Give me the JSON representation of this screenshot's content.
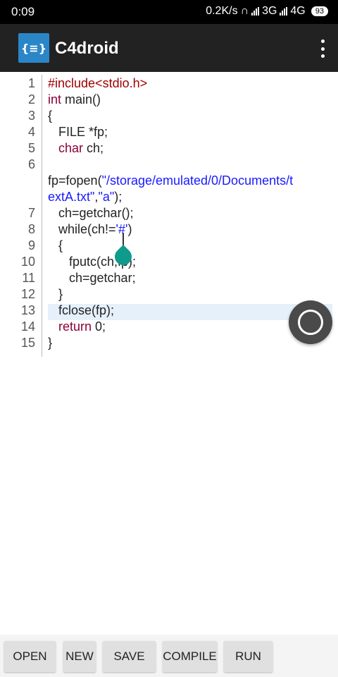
{
  "status_bar": {
    "time": "0:09",
    "net_speed": "0.2K/s",
    "net_3g": "3G",
    "net_4g": "4G",
    "battery": "93"
  },
  "app_bar": {
    "logo_text": "{≡}",
    "title": "C4droid"
  },
  "editor": {
    "current_line": 13,
    "lines": [
      {
        "n": "1",
        "tokens": [
          {
            "t": "#include<stdio.h>",
            "c": "pp"
          }
        ]
      },
      {
        "n": "2",
        "tokens": [
          {
            "t": "int",
            "c": "kw"
          },
          {
            "t": " main()",
            "c": ""
          }
        ]
      },
      {
        "n": "3",
        "tokens": [
          {
            "t": "{",
            "c": ""
          }
        ]
      },
      {
        "n": "4",
        "tokens": [
          {
            "t": "   FILE *fp;",
            "c": ""
          }
        ]
      },
      {
        "n": "5",
        "tokens": [
          {
            "t": "   ",
            "c": ""
          },
          {
            "t": "char",
            "c": "kw"
          },
          {
            "t": " ch;",
            "c": ""
          }
        ]
      },
      {
        "n": "6",
        "tokens": []
      },
      {
        "n": "",
        "tokens": [
          {
            "t": "fp=fopen(",
            "c": ""
          },
          {
            "t": "\"/storage/emulated/0/Documents/t",
            "c": "str"
          }
        ]
      },
      {
        "n": "",
        "tokens": [
          {
            "t": "extA.txt\"",
            "c": "str"
          },
          {
            "t": ",",
            "c": ""
          },
          {
            "t": "\"a\"",
            "c": "str"
          },
          {
            "t": ");",
            "c": ""
          }
        ]
      },
      {
        "n": "7",
        "tokens": [
          {
            "t": "   ch=getchar();",
            "c": ""
          }
        ]
      },
      {
        "n": "8",
        "tokens": [
          {
            "t": "   while(ch!=",
            "c": ""
          },
          {
            "t": "'#'",
            "c": "str"
          },
          {
            "t": ")",
            "c": ""
          }
        ]
      },
      {
        "n": "9",
        "tokens": [
          {
            "t": "   {",
            "c": ""
          }
        ]
      },
      {
        "n": "10",
        "tokens": [
          {
            "t": "      fputc(ch,fp);",
            "c": ""
          }
        ]
      },
      {
        "n": "11",
        "tokens": [
          {
            "t": "      ch=getchar;",
            "c": ""
          }
        ]
      },
      {
        "n": "12",
        "tokens": [
          {
            "t": "   }",
            "c": ""
          }
        ]
      },
      {
        "n": "13",
        "tokens": [
          {
            "t": "   fclose(fp);",
            "c": ""
          }
        ]
      },
      {
        "n": "14",
        "tokens": [
          {
            "t": "   ",
            "c": ""
          },
          {
            "t": "return",
            "c": "kw"
          },
          {
            "t": " 0;",
            "c": ""
          }
        ]
      },
      {
        "n": "15",
        "tokens": [
          {
            "t": "}",
            "c": ""
          }
        ]
      }
    ]
  },
  "bottom_bar": {
    "open_label": "OPEN",
    "new_label": "NEW",
    "save_label": "SAVE",
    "compile_label": "COMPILE",
    "run_label": "RUN"
  },
  "colors": {
    "keyword": "#8b0038",
    "preprocessor": "#a00000",
    "string": "#1a1aff",
    "app_bar": "#222222",
    "logo": "#2b86c8",
    "cursor_handle": "#0e9b8c"
  }
}
